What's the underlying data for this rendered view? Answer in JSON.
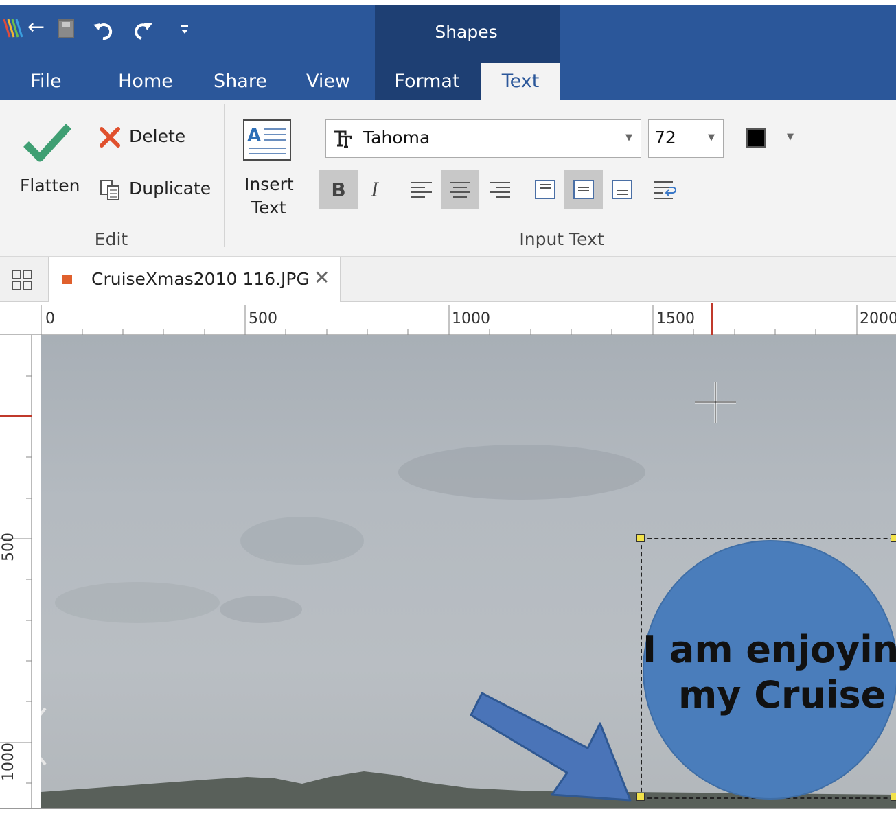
{
  "quick_access": {
    "undo_icon": "undo-icon",
    "redo_icon": "redo-icon",
    "customize_icon": "customize-qat-icon"
  },
  "context_group": {
    "label": "Shapes"
  },
  "tabs": [
    {
      "label": "File"
    },
    {
      "label": "Home"
    },
    {
      "label": "Share"
    },
    {
      "label": "View"
    },
    {
      "label": "Format"
    },
    {
      "label": "Text"
    }
  ],
  "ribbon": {
    "edit": {
      "flatten": "Flatten",
      "delete": "Delete",
      "duplicate": "Duplicate",
      "group_label": "Edit"
    },
    "insert_text": {
      "line1": "Insert",
      "line2": "Text"
    },
    "input_text": {
      "font": "Tahoma",
      "size": "72",
      "group_label": "Input Text",
      "color": "#000000"
    }
  },
  "document_tab": {
    "filename": "CruiseXmas2010 116.JPG"
  },
  "ruler": {
    "h_labels": [
      "0",
      "500",
      "1000",
      "1500",
      "2000"
    ],
    "v_labels": [
      "500",
      "1000"
    ]
  },
  "canvas": {
    "shape_text_line1": "I am enjoying",
    "shape_text_line2": "my Cruise",
    "shape_color": "#4a7dbb",
    "arrow_color": "#4a74b8"
  }
}
